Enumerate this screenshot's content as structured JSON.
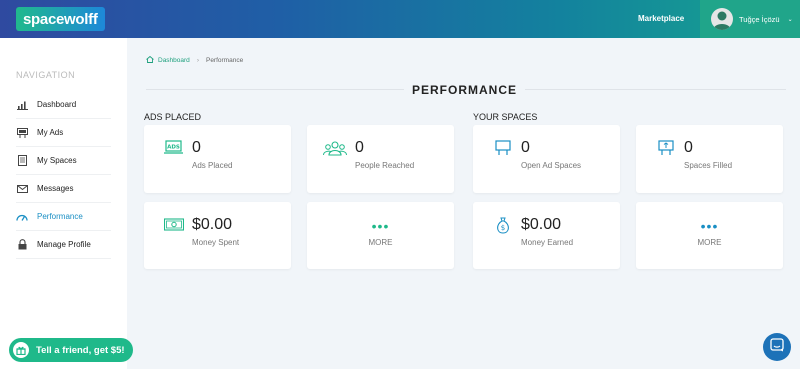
{
  "header": {
    "logo": "spacewolff",
    "nav_link": "Marketplace",
    "user_name": "Tuğçe İçözü",
    "caret": "⌄"
  },
  "sidebar": {
    "title": "NAVIGATION",
    "items": [
      {
        "label": "Dashboard",
        "icon": "bar-chart-icon"
      },
      {
        "label": "My Ads",
        "icon": "billboard-icon"
      },
      {
        "label": "My Spaces",
        "icon": "document-icon"
      },
      {
        "label": "Messages",
        "icon": "envelope-icon"
      },
      {
        "label": "Performance",
        "icon": "speedometer-icon",
        "active": true
      },
      {
        "label": "Manage Profile",
        "icon": "lock-icon"
      }
    ],
    "invite": "Tell a friend, get $5!"
  },
  "breadcrumb": {
    "home": "Dashboard",
    "separator": "›",
    "current": "Performance"
  },
  "page_title": "PERFORMANCE",
  "sections": {
    "ads_placed": "ADS PLACED",
    "your_spaces": "YOUR SPACES"
  },
  "cards": {
    "ads_placed": {
      "value": "0",
      "label": "Ads Placed",
      "icon": "ads-icon"
    },
    "people_reached": {
      "value": "0",
      "label": "People Reached",
      "icon": "people-icon"
    },
    "open_spaces": {
      "value": "0",
      "label": "Open Ad Spaces",
      "icon": "billboard-frame-icon"
    },
    "spaces_filled": {
      "value": "0",
      "label": "Spaces Filled",
      "icon": "billboard-filled-icon"
    },
    "money_spent": {
      "value": "$0.00",
      "label": "Money Spent",
      "icon": "banknote-icon"
    },
    "more_left": {
      "dots": "•••",
      "label": "MORE"
    },
    "money_earned": {
      "value": "$0.00",
      "label": "Money Earned",
      "icon": "money-bag-icon"
    },
    "more_right": {
      "dots": "•••",
      "label": "MORE"
    }
  },
  "colors": {
    "accent_green": "#1fb98a",
    "accent_blue": "#1a8fc4",
    "chat_blue": "#1d72b8"
  }
}
